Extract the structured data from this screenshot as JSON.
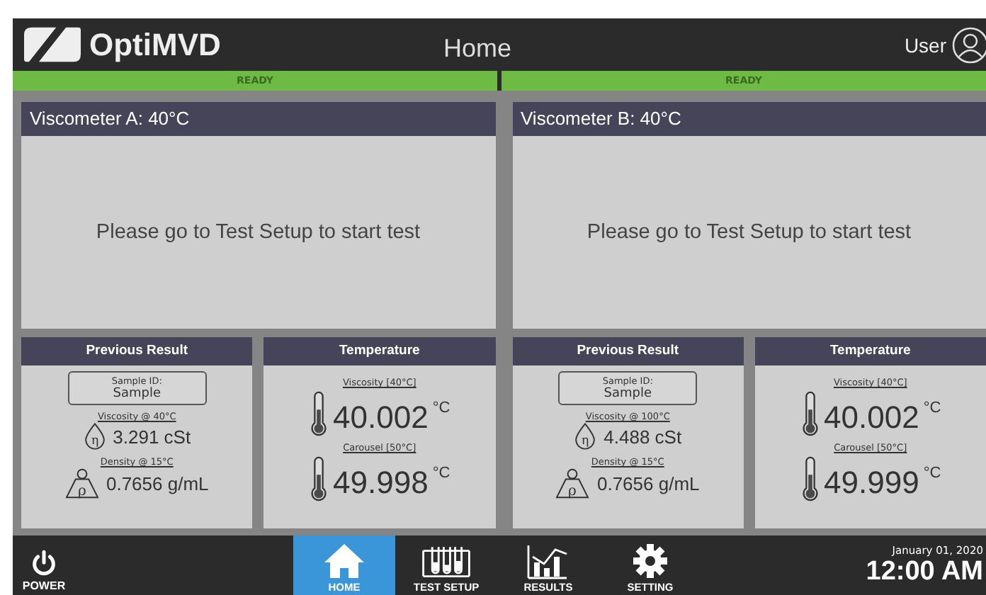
{
  "header": {
    "logo_text": "OptiMVD",
    "title": "Home",
    "user_label": "User"
  },
  "status": [
    {
      "label": "READY"
    },
    {
      "label": "READY"
    }
  ],
  "viscometers": [
    {
      "title": "Viscometer A: 40°C",
      "message": "Please go to Test Setup to start test",
      "previous_result": {
        "title": "Previous Result",
        "sample_id_label": "Sample ID:",
        "sample_id": "Sample",
        "viscosity_label": "Viscosity @ 40°C",
        "viscosity_symbol": "η",
        "viscosity": "3.291 cSt",
        "density_label": "Density @ 15°C",
        "density_symbol": "ρ",
        "density": "0.7656 g/mL"
      },
      "temperature": {
        "title": "Temperature",
        "readings": [
          {
            "label": "Viscosity [40°C]",
            "value": "40.002",
            "unit": "°C"
          },
          {
            "label": "Carousel [50°C]",
            "value": "49.998",
            "unit": "°C"
          }
        ]
      }
    },
    {
      "title": "Viscometer B: 40°C",
      "message": "Please go to Test Setup to start test",
      "previous_result": {
        "title": "Previous Result",
        "sample_id_label": "Sample ID:",
        "sample_id": "Sample",
        "viscosity_label": "Viscosity @ 100°C",
        "viscosity_symbol": "η",
        "viscosity": "4.488 cSt",
        "density_label": "Density @ 15°C",
        "density_symbol": "ρ",
        "density": "0.7656 g/mL"
      },
      "temperature": {
        "title": "Temperature",
        "readings": [
          {
            "label": "Viscosity [40°C]",
            "value": "40.002",
            "unit": "°C"
          },
          {
            "label": "Carousel [50°C]",
            "value": "49.999",
            "unit": "°C"
          }
        ]
      }
    }
  ],
  "nav": {
    "power_label": "POWER",
    "items": [
      {
        "kind": "home",
        "label": "HOME",
        "selected": true
      },
      {
        "kind": "test_setup",
        "label": "TEST SETUP",
        "selected": false
      },
      {
        "kind": "results",
        "label": "RESULTS",
        "selected": false
      },
      {
        "kind": "setting",
        "label": "SETTING",
        "selected": false
      }
    ],
    "date": "January 01, 2020",
    "time": "12:00 AM"
  }
}
